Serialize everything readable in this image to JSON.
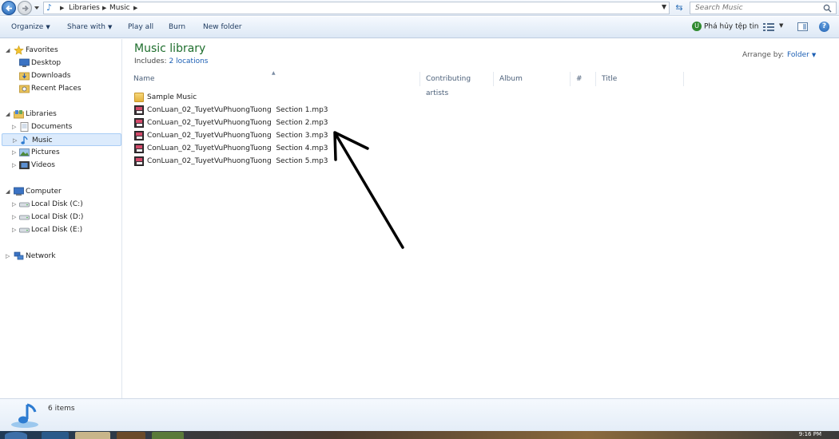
{
  "address_bar": {
    "breadcrumbs": [
      "Libraries",
      "Music"
    ],
    "search_placeholder": "Search Music"
  },
  "toolbar": {
    "organize": "Organize",
    "share_with": "Share with",
    "play_all": "Play all",
    "burn": "Burn",
    "new_folder": "New folder",
    "uninstall": "Phá hủy tệp tin"
  },
  "nav": {
    "favorites": "Favorites",
    "desktop": "Desktop",
    "downloads": "Downloads",
    "recent_places": "Recent Places",
    "libraries": "Libraries",
    "documents": "Documents",
    "music": "Music",
    "pictures": "Pictures",
    "videos": "Videos",
    "computer": "Computer",
    "disk_c": "Local Disk (C:)",
    "disk_d": "Local Disk (D:)",
    "disk_e": "Local Disk (E:)",
    "network": "Network"
  },
  "library": {
    "title": "Music library",
    "includes_label": "Includes:",
    "includes_link": "2 locations",
    "arrange_label": "Arrange by:",
    "arrange_value": "Folder"
  },
  "columns": {
    "name": "Name",
    "contributing_artists": "Contributing artists",
    "album": "Album",
    "number": "#",
    "title": "Title"
  },
  "files": [
    {
      "name": "Sample Music",
      "kind": "folder"
    },
    {
      "name": "ConLuan_02_TuyetVuPhuongTuong  Section 1.mp3",
      "kind": "mp3"
    },
    {
      "name": "ConLuan_02_TuyetVuPhuongTuong  Section 2.mp3",
      "kind": "mp3"
    },
    {
      "name": "ConLuan_02_TuyetVuPhuongTuong  Section 3.mp3",
      "kind": "mp3"
    },
    {
      "name": "ConLuan_02_TuyetVuPhuongTuong  Section 4.mp3",
      "kind": "mp3"
    },
    {
      "name": "ConLuan_02_TuyetVuPhuongTuong  Section 5.mp3",
      "kind": "mp3"
    }
  ],
  "status": {
    "item_count": "6 items"
  },
  "taskbar": {
    "clock": "9:16 PM"
  },
  "colors": {
    "library_title": "#1e6e2d",
    "link": "#1c5fb4",
    "selection": "#dcebfc"
  }
}
